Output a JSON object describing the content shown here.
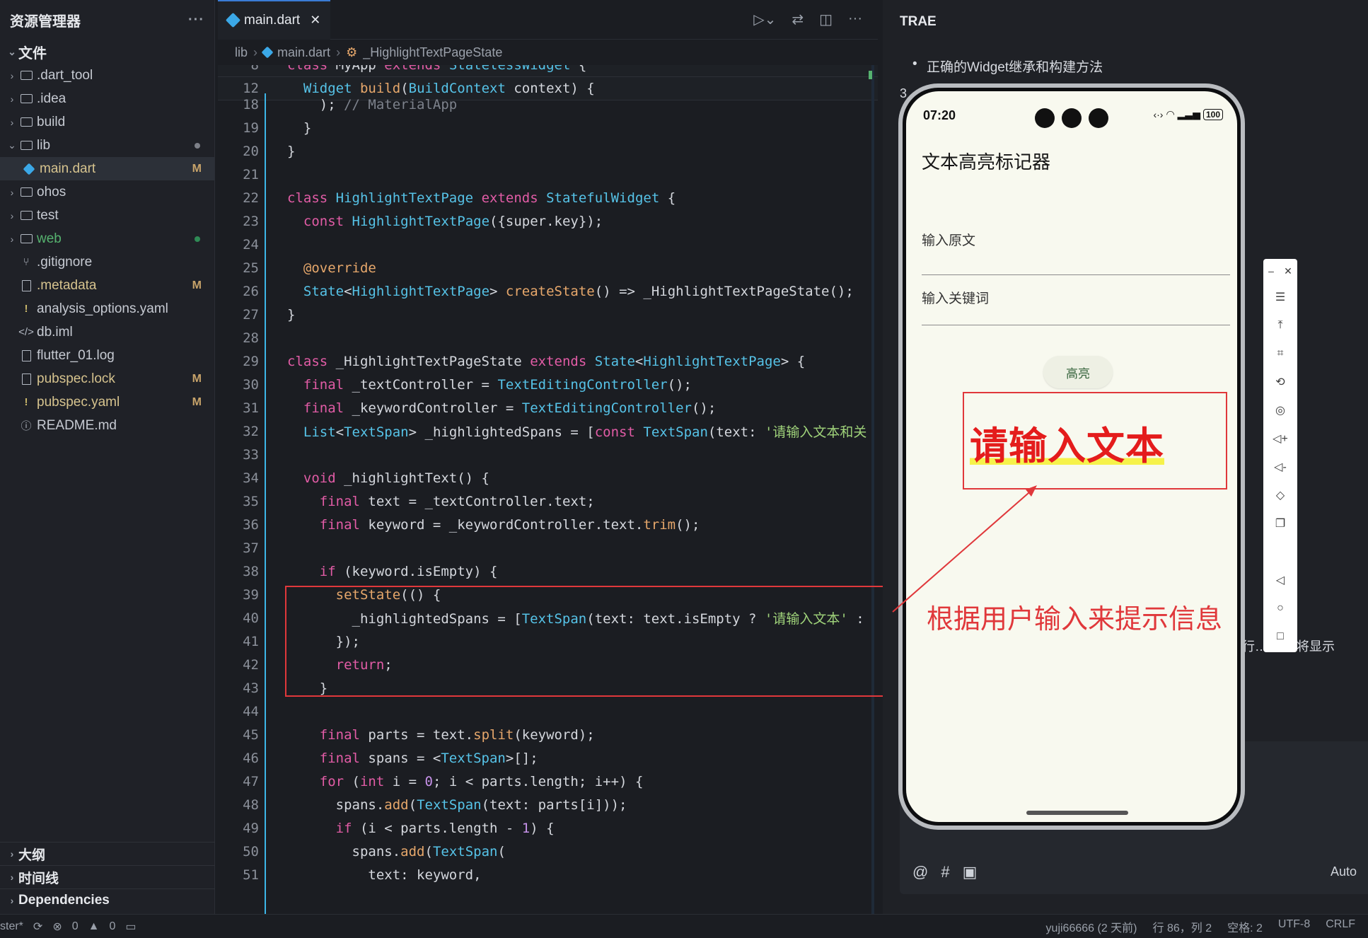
{
  "explorer": {
    "title": "资源管理器",
    "more": "···",
    "section": "文件",
    "items": [
      {
        "label": ".dart_tool",
        "kind": "folder",
        "badge": ""
      },
      {
        "label": ".idea",
        "kind": "folder",
        "badge": ""
      },
      {
        "label": "build",
        "kind": "folder",
        "badge": ""
      },
      {
        "label": "lib",
        "kind": "folder-open",
        "badge": ""
      },
      {
        "label": "main.dart",
        "kind": "dart",
        "badge": "M"
      },
      {
        "label": "ohos",
        "kind": "folder",
        "badge": ""
      },
      {
        "label": "test",
        "kind": "folder",
        "badge": ""
      },
      {
        "label": "web",
        "kind": "folder",
        "badge": ""
      },
      {
        "label": ".gitignore",
        "kind": "git",
        "badge": ""
      },
      {
        "label": ".metadata",
        "kind": "file",
        "badge": "M"
      },
      {
        "label": "analysis_options.yaml",
        "kind": "yaml",
        "badge": ""
      },
      {
        "label": "db.iml",
        "kind": "code",
        "badge": ""
      },
      {
        "label": "flutter_01.log",
        "kind": "file",
        "badge": ""
      },
      {
        "label": "pubspec.lock",
        "kind": "file",
        "badge": "M"
      },
      {
        "label": "pubspec.yaml",
        "kind": "yaml",
        "badge": "M"
      },
      {
        "label": "README.md",
        "kind": "info",
        "badge": ""
      }
    ],
    "bottom_sections": [
      "大纲",
      "时间线",
      "Dependencies"
    ]
  },
  "editor": {
    "tab_label": "main.dart",
    "breadcrumb": [
      "lib",
      "main.dart",
      "_HighlightTextPageState"
    ],
    "sticky_lines": [
      {
        "n": "8",
        "code": "class MyApp extends StatelessWidget {"
      },
      {
        "n": "12",
        "code": "  Widget build(BuildContext context) {"
      }
    ],
    "lines": [
      {
        "n": "18",
        "code": "    ); // MaterialApp"
      },
      {
        "n": "19",
        "code": "  }"
      },
      {
        "n": "20",
        "code": "}"
      },
      {
        "n": "21",
        "code": ""
      },
      {
        "n": "22",
        "code": "class HighlightTextPage extends StatefulWidget {"
      },
      {
        "n": "23",
        "code": "  const HighlightTextPage({super.key});"
      },
      {
        "n": "24",
        "code": ""
      },
      {
        "n": "25",
        "code": "  @override"
      },
      {
        "n": "26",
        "code": "  State<HighlightTextPage> createState() => _HighlightTextPageState();"
      },
      {
        "n": "27",
        "code": "}"
      },
      {
        "n": "28",
        "code": ""
      },
      {
        "n": "29",
        "code": "class _HighlightTextPageState extends State<HighlightTextPage> {"
      },
      {
        "n": "30",
        "code": "  final _textController = TextEditingController();"
      },
      {
        "n": "31",
        "code": "  final _keywordController = TextEditingController();"
      },
      {
        "n": "32",
        "code": "  List<TextSpan> _highlightedSpans = [const TextSpan(text: '请输入文本和关"
      },
      {
        "n": "33",
        "code": ""
      },
      {
        "n": "34",
        "code": "  void _highlightText() {"
      },
      {
        "n": "35",
        "code": "    final text = _textController.text;"
      },
      {
        "n": "36",
        "code": "    final keyword = _keywordController.text.trim();"
      },
      {
        "n": "37",
        "code": ""
      },
      {
        "n": "38",
        "code": "    if (keyword.isEmpty) {"
      },
      {
        "n": "39",
        "code": "      setState(() {"
      },
      {
        "n": "40",
        "code": "        _highlightedSpans = [TextSpan(text: text.isEmpty ? '请输入文本' :"
      },
      {
        "n": "41",
        "code": "      });"
      },
      {
        "n": "42",
        "code": "      return;"
      },
      {
        "n": "43",
        "code": "    }"
      },
      {
        "n": "44",
        "code": ""
      },
      {
        "n": "45",
        "code": "    final parts = text.split(keyword);"
      },
      {
        "n": "46",
        "code": "    final spans = <TextSpan>[];"
      },
      {
        "n": "47",
        "code": "    for (int i = 0; i < parts.length; i++) {"
      },
      {
        "n": "48",
        "code": "      spans.add(TextSpan(text: parts[i]));"
      },
      {
        "n": "49",
        "code": "      if (i < parts.length - 1) {"
      },
      {
        "n": "50",
        "code": "        spans.add(TextSpan("
      },
      {
        "n": "51",
        "code": "          text: keyword,"
      }
    ]
  },
  "trae": {
    "title": "TRAE",
    "bullet": "正确的Widget继承和构建方法",
    "number": "3",
    "partial_text": "行… ，它将显示",
    "input_icons": [
      "@",
      "#",
      "▣"
    ],
    "mode": "Auto"
  },
  "phone": {
    "time": "07:20",
    "battery": "100",
    "app_title": "文本高亮标记器",
    "field1_label": "输入原文",
    "field2_label": "输入关键词",
    "button_label": "高亮",
    "result_text": "请输入文本"
  },
  "annotation": {
    "callout": "根据用户输入来提示信息"
  },
  "emulator_toolbar": {
    "buttons": [
      "menu-icon",
      "pin-top-icon",
      "crop-icon",
      "rotate-icon",
      "screenshot-icon",
      "volume-up-icon",
      "volume-down-icon",
      "shake-icon",
      "copy-icon",
      "back-icon",
      "home-icon",
      "recents-icon"
    ]
  },
  "statusbar": {
    "branch": "ster*",
    "errors": "0",
    "warnings": "0",
    "author": "yuji66666 (2 天前)",
    "position": "行 86，列 2",
    "spaces": "空格: 2",
    "encoding": "UTF-8",
    "eol": "CRLF"
  },
  "colors": {
    "accent": "#3a7bd5",
    "annotation_red": "#e0383b",
    "result_red": "#e41c1c",
    "highlight_yellow": "#f6f24a"
  }
}
